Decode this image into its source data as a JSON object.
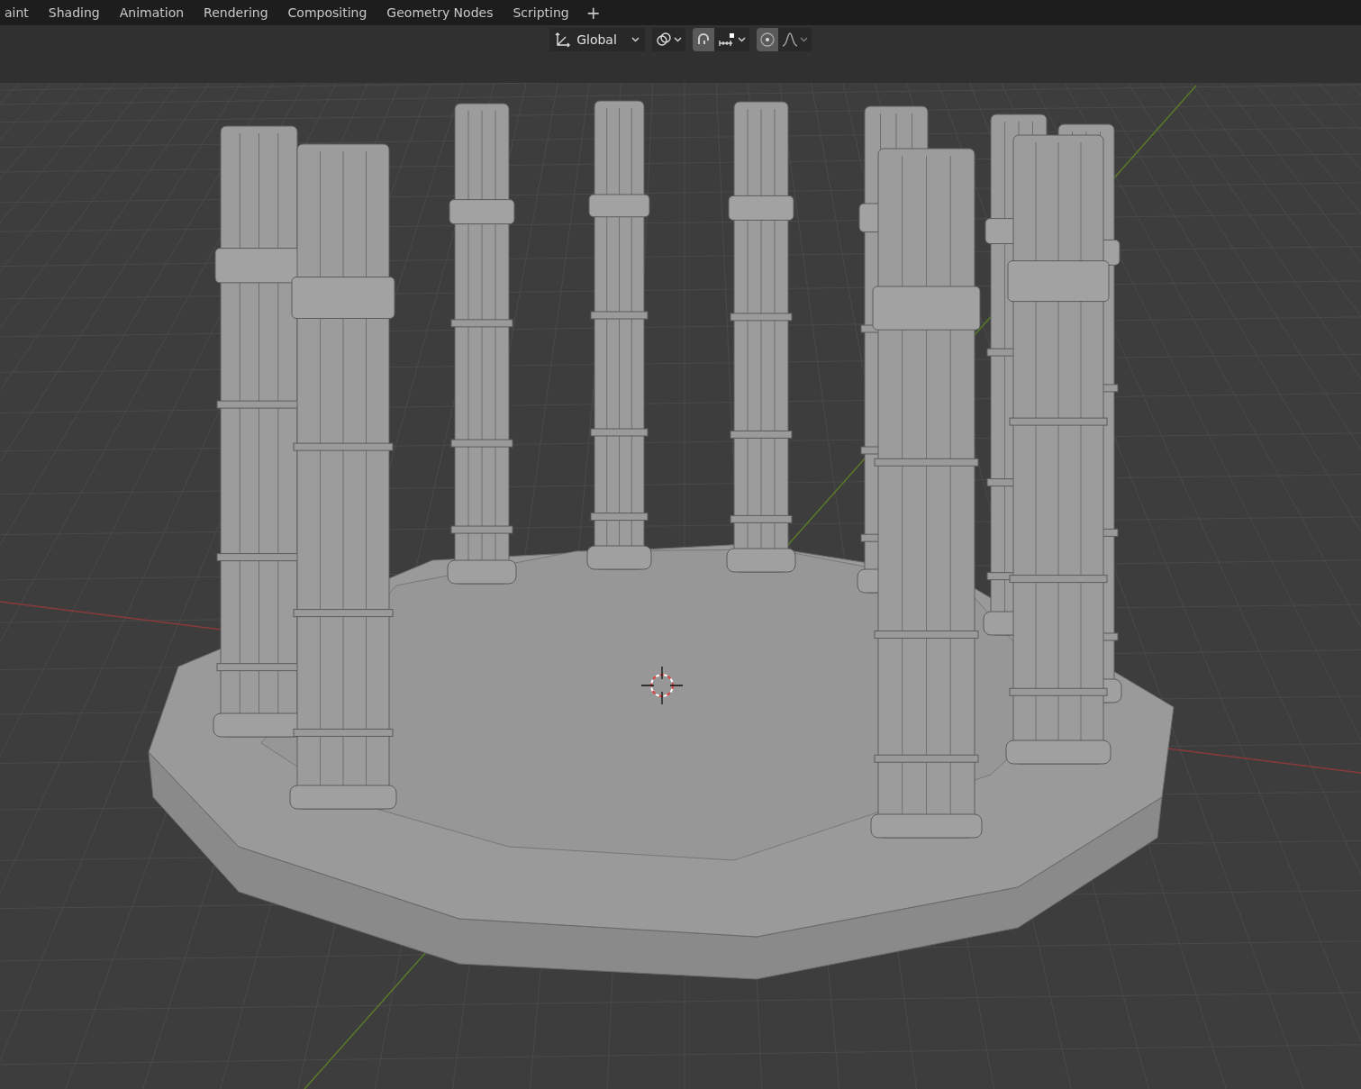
{
  "workspace_tabs": [
    {
      "label": "aint",
      "selected": false
    },
    {
      "label": "Shading",
      "selected": false
    },
    {
      "label": "Animation",
      "selected": false
    },
    {
      "label": "Rendering",
      "selected": false
    },
    {
      "label": "Compositing",
      "selected": false
    },
    {
      "label": "Geometry Nodes",
      "selected": false
    },
    {
      "label": "Scripting",
      "selected": false
    }
  ],
  "add_tab": "+",
  "header": {
    "transform_orientation": "Global",
    "snap": {
      "on": true
    },
    "proportional_editing": {
      "on": true
    }
  }
}
